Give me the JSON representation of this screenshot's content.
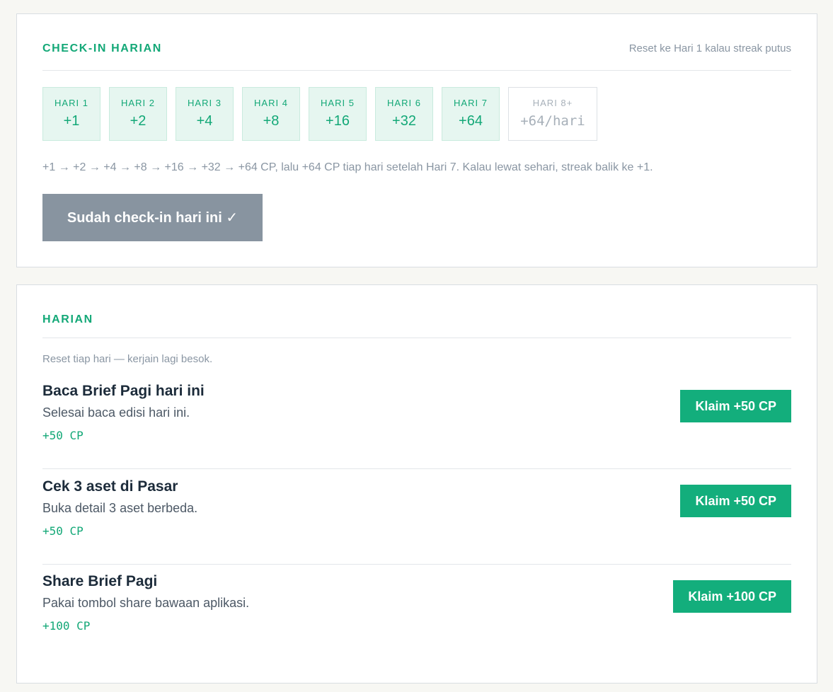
{
  "checkin": {
    "title": "CHECK-IN HARIAN",
    "note": "Reset ke Hari 1 kalau streak putus",
    "days": [
      {
        "label": "HARI 1",
        "value": "+1"
      },
      {
        "label": "HARI 2",
        "value": "+2"
      },
      {
        "label": "HARI 3",
        "value": "+4"
      },
      {
        "label": "HARI 4",
        "value": "+8"
      },
      {
        "label": "HARI 5",
        "value": "+16"
      },
      {
        "label": "HARI 6",
        "value": "+32"
      },
      {
        "label": "HARI 7",
        "value": "+64"
      },
      {
        "label": "HARI 8+",
        "value": "+64/hari"
      }
    ],
    "description": "+1 → +2 → +4 → +8 → +16 → +32 → +64 CP, lalu +64  CP tiap hari setelah Hari 7. Kalau lewat sehari, streak balik ke +1.",
    "button_label": "Sudah check-in hari ini ✓"
  },
  "daily": {
    "title": "HARIAN",
    "note": "Reset tiap hari — kerjain lagi besok.",
    "quests": [
      {
        "title": "Baca Brief Pagi hari ini",
        "desc": "Selesai baca edisi hari ini.",
        "reward": "+50 CP",
        "button": "Klaim +50 CP"
      },
      {
        "title": "Cek 3 aset di Pasar",
        "desc": "Buka detail 3 aset berbeda.",
        "reward": "+50 CP",
        "button": "Klaim +50 CP"
      },
      {
        "title": "Share Brief Pagi",
        "desc": "Pakai tombol share bawaan aplikasi.",
        "reward": "+100 CP",
        "button": "Klaim +100 CP"
      }
    ]
  },
  "colors": {
    "accent": "#13a877",
    "button_disabled": "#8894a0",
    "day_bg": "#e6f6f0"
  }
}
